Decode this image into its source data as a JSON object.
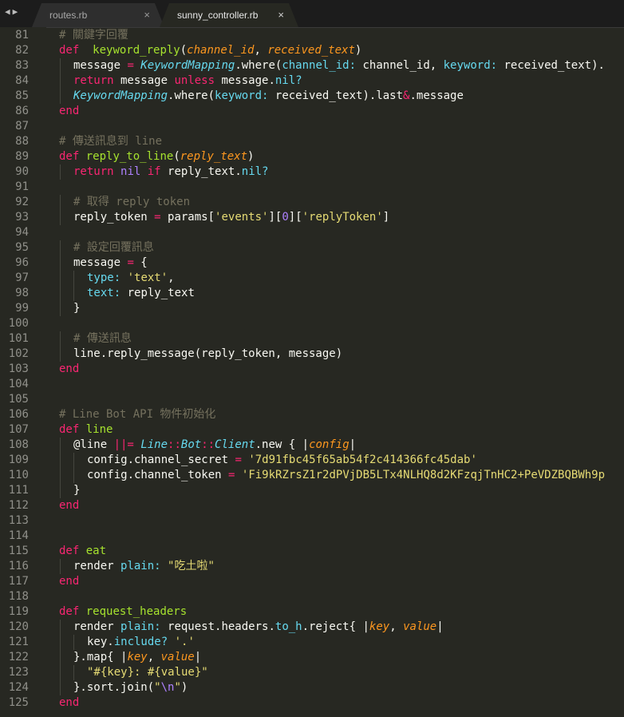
{
  "tabs": [
    {
      "label": "routes.rb",
      "active": false
    },
    {
      "label": "sunny_controller.rb",
      "active": true
    }
  ],
  "nav_arrows": "◀▶",
  "close_glyph": "×",
  "colors": {
    "background": "#272822",
    "keyword": "#f92672",
    "entity": "#a6e22e",
    "comment": "#75715e",
    "string": "#e6db74",
    "constant": "#ae81ff",
    "support": "#66d9ef",
    "parameter": "#fd971f"
  },
  "lines": [
    {
      "n": "81",
      "indent": 0,
      "tokens": [
        [
          "c",
          "# 關鍵字回覆"
        ]
      ]
    },
    {
      "n": "82",
      "indent": 0,
      "tokens": [
        [
          "k",
          "def"
        ],
        [
          "",
          "  "
        ],
        [
          "e",
          "keyword_reply"
        ],
        [
          "",
          "("
        ],
        [
          "p",
          "channel_id"
        ],
        [
          "",
          ", "
        ],
        [
          "p",
          "received_text"
        ],
        [
          "",
          ")"
        ]
      ]
    },
    {
      "n": "83",
      "indent": 1,
      "tokens": [
        [
          "",
          "message "
        ],
        [
          "k",
          "="
        ],
        [
          "",
          ""
        ],
        [
          "t",
          " KeywordMapping"
        ],
        [
          "",
          "."
        ],
        [
          "",
          ""
        ],
        [
          "",
          "where("
        ],
        [
          "f",
          "channel_id:"
        ],
        [
          "",
          ""
        ],
        [
          "",
          " channel_id, "
        ],
        [
          "f",
          "keyword:"
        ],
        [
          "",
          " received_text)."
        ]
      ]
    },
    {
      "n": "84",
      "indent": 1,
      "tokens": [
        [
          "k",
          "return"
        ],
        [
          "",
          " message "
        ],
        [
          "k",
          "unless"
        ],
        [
          "",
          " message."
        ],
        [
          "f",
          "nil?"
        ]
      ]
    },
    {
      "n": "85",
      "indent": 1,
      "tokens": [
        [
          "t",
          "KeywordMapping"
        ],
        [
          "",
          ".where("
        ],
        [
          "f",
          "keyword:"
        ],
        [
          "",
          " received_text).last"
        ],
        [
          "k",
          "&"
        ],
        [
          "",
          ".message"
        ]
      ]
    },
    {
      "n": "86",
      "indent": 0,
      "tokens": [
        [
          "k",
          "end"
        ]
      ]
    },
    {
      "n": "87",
      "indent": 0,
      "tokens": []
    },
    {
      "n": "88",
      "indent": 0,
      "tokens": [
        [
          "c",
          "# 傳送訊息到 line"
        ]
      ]
    },
    {
      "n": "89",
      "indent": 0,
      "tokens": [
        [
          "k",
          "def"
        ],
        [
          "",
          " "
        ],
        [
          "e",
          "reply_to_line"
        ],
        [
          "",
          "("
        ],
        [
          "p",
          "reply_text"
        ],
        [
          "",
          ")"
        ]
      ]
    },
    {
      "n": "90",
      "indent": 1,
      "tokens": [
        [
          "k",
          "return"
        ],
        [
          "",
          " "
        ],
        [
          "n",
          "nil"
        ],
        [
          "",
          " "
        ],
        [
          "k",
          "if"
        ],
        [
          "",
          " reply_text."
        ],
        [
          "f",
          "nil?"
        ]
      ]
    },
    {
      "n": "91",
      "indent": 0,
      "tokens": []
    },
    {
      "n": "92",
      "indent": 1,
      "tokens": [
        [
          "c",
          "# 取得 reply token"
        ]
      ]
    },
    {
      "n": "93",
      "indent": 1,
      "tokens": [
        [
          "",
          "reply_token "
        ],
        [
          "k",
          "="
        ],
        [
          "",
          " params["
        ],
        [
          "s",
          "'events'"
        ],
        [
          "",
          "]["
        ],
        [
          "n",
          "0"
        ],
        [
          "",
          "]["
        ],
        [
          "s",
          "'replyToken'"
        ],
        [
          "",
          "]"
        ]
      ]
    },
    {
      "n": "94",
      "indent": 0,
      "tokens": []
    },
    {
      "n": "95",
      "indent": 1,
      "tokens": [
        [
          "c",
          "# 設定回覆訊息"
        ]
      ]
    },
    {
      "n": "96",
      "indent": 1,
      "tokens": [
        [
          "",
          "message "
        ],
        [
          "k",
          "="
        ],
        [
          "",
          " {"
        ]
      ]
    },
    {
      "n": "97",
      "indent": 2,
      "tokens": [
        [
          "f",
          "type:"
        ],
        [
          "",
          " "
        ],
        [
          "s",
          "'text'"
        ],
        [
          "",
          ","
        ]
      ]
    },
    {
      "n": "98",
      "indent": 2,
      "tokens": [
        [
          "f",
          "text:"
        ],
        [
          "",
          " reply_text"
        ]
      ]
    },
    {
      "n": "99",
      "indent": 1,
      "tokens": [
        [
          "",
          "}"
        ]
      ]
    },
    {
      "n": "100",
      "indent": 0,
      "tokens": []
    },
    {
      "n": "101",
      "indent": 1,
      "tokens": [
        [
          "c",
          "# 傳送訊息"
        ]
      ]
    },
    {
      "n": "102",
      "indent": 1,
      "tokens": [
        [
          "",
          "line.reply_message(reply_token, message)"
        ]
      ]
    },
    {
      "n": "103",
      "indent": 0,
      "tokens": [
        [
          "k",
          "end"
        ]
      ]
    },
    {
      "n": "104",
      "indent": 0,
      "tokens": []
    },
    {
      "n": "105",
      "indent": 0,
      "tokens": []
    },
    {
      "n": "106",
      "indent": 0,
      "tokens": [
        [
          "c",
          "# Line Bot API 物件初始化"
        ]
      ]
    },
    {
      "n": "107",
      "indent": 0,
      "tokens": [
        [
          "k",
          "def"
        ],
        [
          "",
          " "
        ],
        [
          "e",
          "line"
        ]
      ]
    },
    {
      "n": "108",
      "indent": 1,
      "tokens": [
        [
          "",
          "@line "
        ],
        [
          "k",
          "||="
        ],
        [
          "",
          " "
        ],
        [
          "t",
          "Line"
        ],
        [
          "k",
          "::"
        ],
        [
          "t",
          "Bot"
        ],
        [
          "k",
          "::"
        ],
        [
          "t",
          "Client"
        ],
        [
          "",
          ".new { |"
        ],
        [
          "p",
          "config"
        ],
        [
          "",
          "|"
        ]
      ]
    },
    {
      "n": "109",
      "indent": 2,
      "tokens": [
        [
          "",
          "config.channel_secret "
        ],
        [
          "k",
          "="
        ],
        [
          "",
          " "
        ],
        [
          "s",
          "'7d91fbc45f65ab54f2c414366fc45dab'"
        ]
      ]
    },
    {
      "n": "110",
      "indent": 2,
      "tokens": [
        [
          "",
          "config.channel_token "
        ],
        [
          "k",
          "="
        ],
        [
          "",
          " "
        ],
        [
          "s",
          "'Fi9kRZrsZ1r2dPVjDB5LTx4NLHQ8d2KFzqjTnHC2+PeVDZBQBWh9p"
        ]
      ]
    },
    {
      "n": "111",
      "indent": 1,
      "tokens": [
        [
          "",
          "}"
        ]
      ]
    },
    {
      "n": "112",
      "indent": 0,
      "tokens": [
        [
          "k",
          "end"
        ]
      ]
    },
    {
      "n": "113",
      "indent": 0,
      "tokens": []
    },
    {
      "n": "114",
      "indent": 0,
      "tokens": []
    },
    {
      "n": "115",
      "indent": 0,
      "tokens": [
        [
          "k",
          "def"
        ],
        [
          "",
          " "
        ],
        [
          "e",
          "eat"
        ]
      ]
    },
    {
      "n": "116",
      "indent": 1,
      "tokens": [
        [
          "",
          "render "
        ],
        [
          "f",
          "plain:"
        ],
        [
          "",
          " "
        ],
        [
          "s",
          "\"吃土啦\""
        ]
      ]
    },
    {
      "n": "117",
      "indent": 0,
      "tokens": [
        [
          "k",
          "end"
        ]
      ]
    },
    {
      "n": "118",
      "indent": 0,
      "tokens": []
    },
    {
      "n": "119",
      "indent": 0,
      "tokens": [
        [
          "k",
          "def"
        ],
        [
          "",
          " "
        ],
        [
          "e",
          "request_headers"
        ]
      ]
    },
    {
      "n": "120",
      "indent": 1,
      "tokens": [
        [
          "",
          "render "
        ],
        [
          "f",
          "plain:"
        ],
        [
          "",
          " request.headers."
        ],
        [
          "f",
          "to_h"
        ],
        [
          "",
          ".reject{ |"
        ],
        [
          "p",
          "key"
        ],
        [
          "",
          ", "
        ],
        [
          "p",
          "value"
        ],
        [
          "",
          "|"
        ]
      ]
    },
    {
      "n": "121",
      "indent": 2,
      "tokens": [
        [
          "",
          "key."
        ],
        [
          "f",
          "include?"
        ],
        [
          "",
          " "
        ],
        [
          "s",
          "'.'"
        ]
      ]
    },
    {
      "n": "122",
      "indent": 1,
      "tokens": [
        [
          "",
          "}.map{ |"
        ],
        [
          "p",
          "key"
        ],
        [
          "",
          ", "
        ],
        [
          "p",
          "value"
        ],
        [
          "",
          "|"
        ]
      ]
    },
    {
      "n": "123",
      "indent": 2,
      "tokens": [
        [
          "s",
          "\"#{key}: #{value}\""
        ]
      ]
    },
    {
      "n": "124",
      "indent": 1,
      "tokens": [
        [
          "",
          "}.sort.join("
        ],
        [
          "s",
          "\""
        ],
        [
          "n",
          "\\n"
        ],
        [
          "s",
          "\""
        ],
        [
          "",
          ")"
        ]
      ]
    },
    {
      "n": "125",
      "indent": 0,
      "tokens": [
        [
          "k",
          "end"
        ]
      ]
    }
  ]
}
